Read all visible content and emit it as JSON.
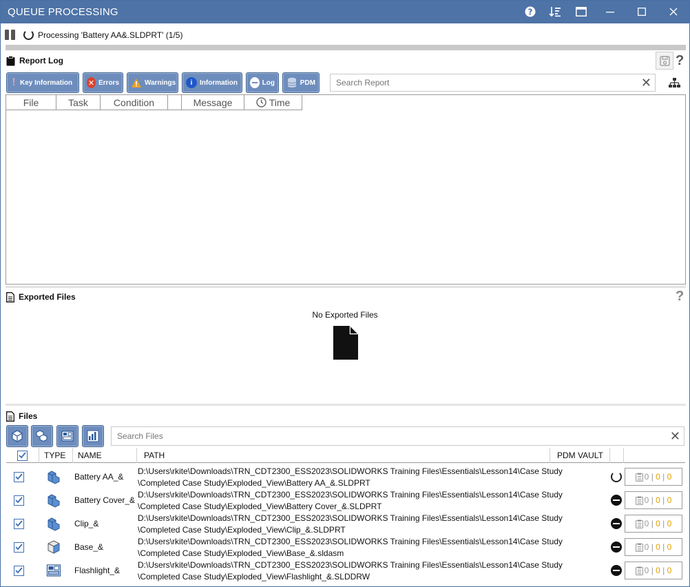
{
  "window": {
    "title": "QUEUE PROCESSING"
  },
  "processing": {
    "text": "Processing 'Battery AA&.SLDPRT' (1/5)",
    "progress_fraction": 0.0
  },
  "report_log": {
    "title": "Report Log",
    "filters": [
      {
        "label": "Key Information",
        "icon": "exclamation-icon"
      },
      {
        "label": "Errors",
        "icon": "error-icon"
      },
      {
        "label": "Warnings",
        "icon": "warning-icon"
      },
      {
        "label": "Information",
        "icon": "info-icon"
      },
      {
        "label": "Log",
        "icon": "log-icon"
      },
      {
        "label": "PDM",
        "icon": "database-icon"
      }
    ],
    "search_placeholder": "Search Report",
    "columns": [
      "File",
      "Task",
      "Condition",
      "",
      "Message",
      "Time"
    ]
  },
  "exported_files": {
    "title": "Exported Files",
    "empty_text": "No Exported Files"
  },
  "files": {
    "title": "Files",
    "search_placeholder": "Search Files",
    "columns": {
      "type": "TYPE",
      "name": "NAME",
      "path": "PATH",
      "pdm_vault": "PDM VAULT"
    },
    "rows": [
      {
        "checked": true,
        "type": "part",
        "name": "Battery AA_&",
        "path_line1": "D:\\Users\\rkite\\Downloads\\TRN_CDT2300_ESS2023\\SOLIDWORKS Training Files\\Essentials\\Lesson14\\Case Study",
        "path_line2": "\\Completed Case Study\\Exploded_View\\Battery AA_&.SLDPRT",
        "status": "processing",
        "counts": [
          "0",
          "0",
          "0"
        ]
      },
      {
        "checked": true,
        "type": "part",
        "name": "Battery Cover_&",
        "path_line1": "D:\\Users\\rkite\\Downloads\\TRN_CDT2300_ESS2023\\SOLIDWORKS Training Files\\Essentials\\Lesson14\\Case Study",
        "path_line2": "\\Completed Case Study\\Exploded_View\\Battery Cover_&.SLDPRT",
        "status": "pending",
        "counts": [
          "0",
          "0",
          "0"
        ]
      },
      {
        "checked": true,
        "type": "part",
        "name": "Clip_&",
        "path_line1": "D:\\Users\\rkite\\Downloads\\TRN_CDT2300_ESS2023\\SOLIDWORKS Training Files\\Essentials\\Lesson14\\Case Study",
        "path_line2": "\\Completed Case Study\\Exploded_View\\Clip_&.SLDPRT",
        "status": "pending",
        "counts": [
          "0",
          "0",
          "0"
        ]
      },
      {
        "checked": true,
        "type": "assembly",
        "name": "Base_&",
        "path_line1": "D:\\Users\\rkite\\Downloads\\TRN_CDT2300_ESS2023\\SOLIDWORKS Training Files\\Essentials\\Lesson14\\Case Study",
        "path_line2": "\\Completed Case Study\\Exploded_View\\Base_&.sldasm",
        "status": "pending",
        "counts": [
          "0",
          "0",
          "0"
        ]
      },
      {
        "checked": true,
        "type": "drawing",
        "name": "Flashlight_&",
        "path_line1": "D:\\Users\\rkite\\Downloads\\TRN_CDT2300_ESS2023\\SOLIDWORKS Training Files\\Essentials\\Lesson14\\Case Study",
        "path_line2": "\\Completed Case Study\\Exploded_View\\Flashlight_&.SLDDRW",
        "status": "pending",
        "counts": [
          "0",
          "0",
          "0"
        ]
      }
    ]
  },
  "colors": {
    "titlebar": "#4e73a6",
    "button": "#6d8dbd",
    "error": "#d9432f",
    "warning": "#f0a020",
    "info": "#2157c9"
  }
}
